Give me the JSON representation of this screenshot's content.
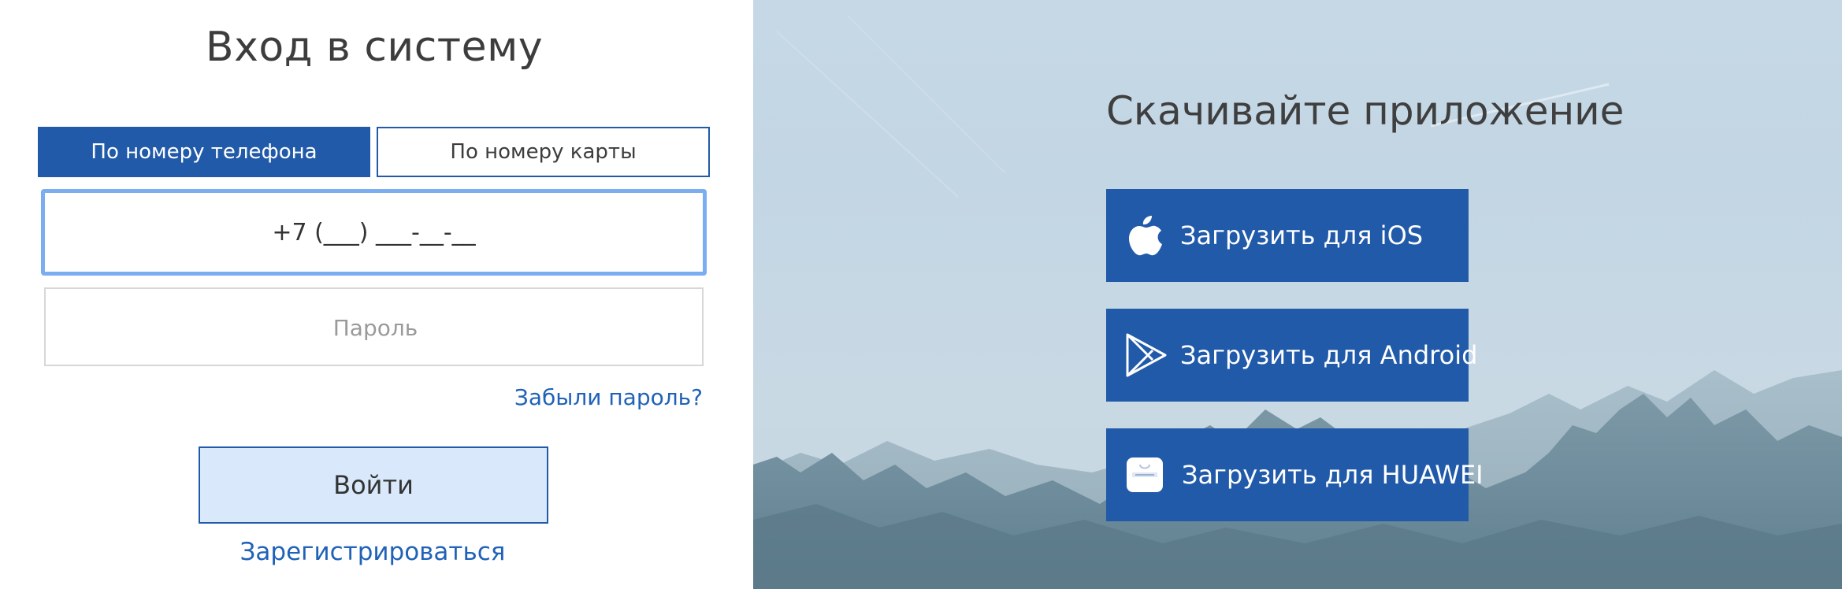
{
  "login": {
    "title": "Вход в систему",
    "tabs": [
      {
        "label": "По номеру телефона",
        "active": true
      },
      {
        "label": "По номеру карты",
        "active": false
      }
    ],
    "phone_mask": "+7 (___) ___-__-__",
    "password_placeholder": "Пароль",
    "forgot_label": "Забыли пароль?",
    "submit_label": "Войти",
    "register_label": "Зарегистрироваться"
  },
  "promo": {
    "title": "Скачивайте приложение",
    "buttons": [
      {
        "label": "Загрузить для iOS",
        "icon": "apple-icon"
      },
      {
        "label": "Загрузить для Android",
        "icon": "google-play-icon"
      },
      {
        "label": "Загрузить для HUAWEI",
        "icon": "huawei-appgallery-icon"
      }
    ]
  },
  "colors": {
    "brand": "#215aa9",
    "link": "#1f62b7",
    "focus_border": "#7aaef0",
    "submit_bg": "#d9e9fb"
  }
}
